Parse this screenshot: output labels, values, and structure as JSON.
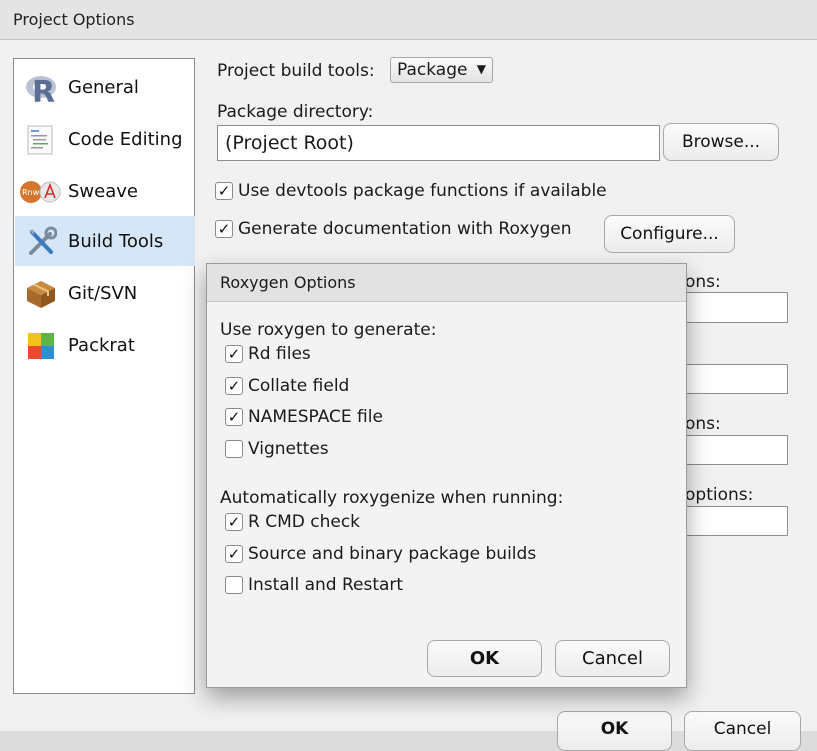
{
  "window": {
    "title": "Project Options"
  },
  "sidebar": {
    "items": [
      {
        "label": "General",
        "icon": "r-logo-icon",
        "selected": false
      },
      {
        "label": "Code Editing",
        "icon": "code-document-icon",
        "selected": false
      },
      {
        "label": "Sweave",
        "icon": "sweave-pdf-icon",
        "selected": false
      },
      {
        "label": "Build Tools",
        "icon": "tools-icon",
        "selected": true
      },
      {
        "label": "Git/SVN",
        "icon": "package-box-icon",
        "selected": false
      },
      {
        "label": "Packrat",
        "icon": "packrat-blocks-icon",
        "selected": false
      }
    ]
  },
  "build": {
    "build_tools_label": "Project build tools:",
    "build_tools_value": "Package",
    "package_dir_label": "Package directory:",
    "package_dir_value": "(Project Root)",
    "browse_label": "Browse...",
    "devtools_label": "Use devtools package functions if available",
    "devtools_checked": true,
    "roxygen_label": "Generate documentation with Roxygen",
    "roxygen_checked": true,
    "configure_label": "Configure...",
    "partial_label_1": "ons:",
    "partial_label_3": "ons:",
    "partial_label_4": "options:",
    "ok_label": "OK",
    "cancel_label": "Cancel"
  },
  "roxygen_dialog": {
    "title": "Roxygen Options",
    "generate_heading": "Use roxygen to generate:",
    "generate_options": [
      {
        "label": "Rd files",
        "checked": true
      },
      {
        "label": "Collate field",
        "checked": true
      },
      {
        "label": "NAMESPACE file",
        "checked": true
      },
      {
        "label": "Vignettes",
        "checked": false
      }
    ],
    "auto_heading": "Automatically roxygenize when running:",
    "auto_options": [
      {
        "label": "R CMD check",
        "checked": true
      },
      {
        "label": "Source and binary package builds",
        "checked": true
      },
      {
        "label": "Install and Restart",
        "checked": false
      }
    ],
    "ok_label": "OK",
    "cancel_label": "Cancel"
  },
  "colors": {
    "selected_bg": "#d5e6f7",
    "dialog_bg": "#f1f1f1"
  }
}
